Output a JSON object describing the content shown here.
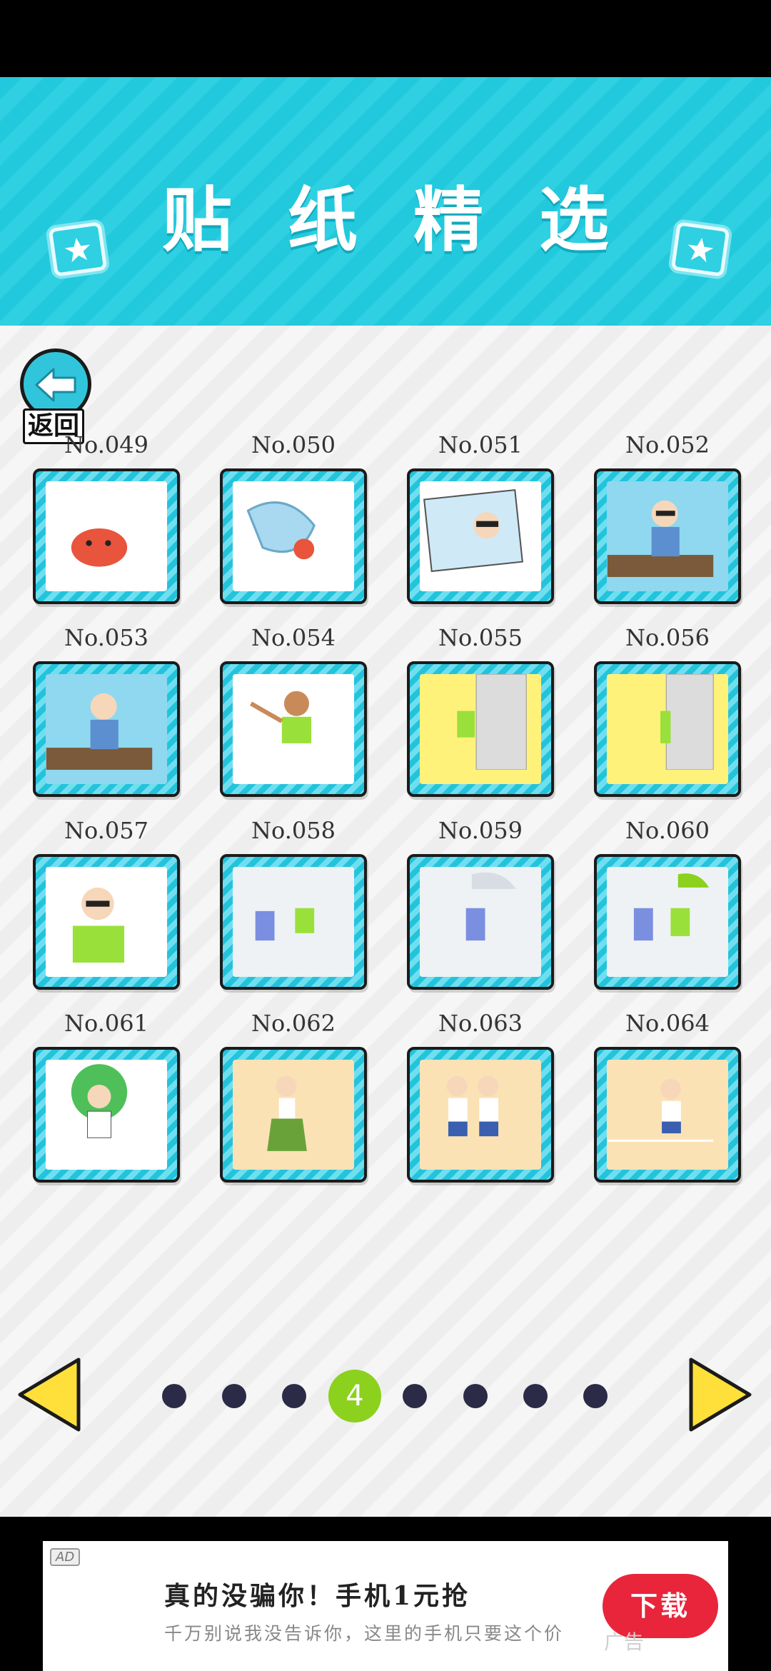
{
  "header": {
    "title": "贴纸精选"
  },
  "back": {
    "label": "返回"
  },
  "stickers": [
    {
      "id": "No.049",
      "scene": "crab",
      "bg": "#ffffff"
    },
    {
      "id": "No.050",
      "scene": "hermit-crab",
      "bg": "#ffffff"
    },
    {
      "id": "No.051",
      "scene": "photo-woman-sunglasses",
      "bg": "#ffffff"
    },
    {
      "id": "No.052",
      "scene": "boy-sunglasses-balcony",
      "bg": "#8fd8ef"
    },
    {
      "id": "No.053",
      "scene": "boy-laughing-balcony",
      "bg": "#8fd8ef"
    },
    {
      "id": "No.054",
      "scene": "boy-throwing",
      "bg": "#ffffff"
    },
    {
      "id": "No.055",
      "scene": "door-yellow-peek",
      "bg": "#fff27a"
    },
    {
      "id": "No.056",
      "scene": "door-yellow-side",
      "bg": "#fff27a"
    },
    {
      "id": "No.057",
      "scene": "boy-sunglasses-green",
      "bg": "#ffffff"
    },
    {
      "id": "No.058",
      "scene": "station-girl-boy",
      "bg": "#eef2f5"
    },
    {
      "id": "No.059",
      "scene": "girl-umbrella",
      "bg": "#eef2f5"
    },
    {
      "id": "No.060",
      "scene": "girl-boy-umbrella",
      "bg": "#eef2f5"
    },
    {
      "id": "No.061",
      "scene": "peacock-boy",
      "bg": "#ffffff"
    },
    {
      "id": "No.062",
      "scene": "hula-girl",
      "bg": "#fbe2b5"
    },
    {
      "id": "No.063",
      "scene": "boy-girl-pose",
      "bg": "#fbe2b5"
    },
    {
      "id": "No.064",
      "scene": "running-race",
      "bg": "#fbe2b5"
    }
  ],
  "pagination": {
    "current": "4",
    "total_pages": 8,
    "current_index": 3
  },
  "ad": {
    "badge": "AD",
    "title": "真的没骗你！手机1元抢",
    "subtitle": "千万别说我没告诉你，这里的手机只要这个价",
    "button": "下载",
    "watermark": "广告"
  },
  "colors": {
    "accent": "#2ed0e2",
    "active_dot": "#8cd11e",
    "ad_button": "#e8253b",
    "arrow": "#ffe03a"
  }
}
